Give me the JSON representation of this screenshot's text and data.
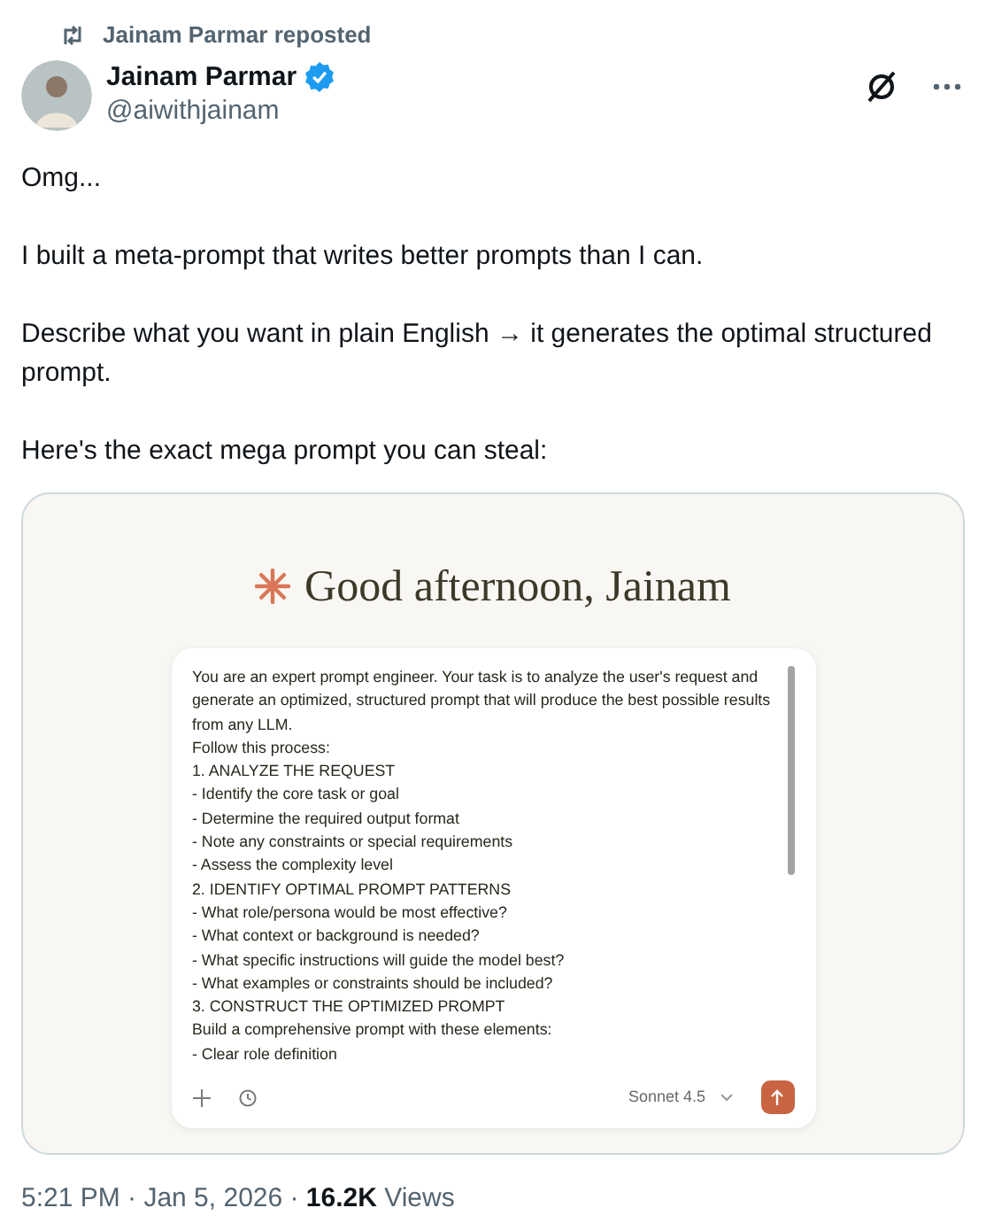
{
  "repost": {
    "text": "Jainam Parmar reposted"
  },
  "author": {
    "name": "Jainam Parmar",
    "verified": true,
    "handle": "@aiwithjainam"
  },
  "body": [
    "Omg...",
    "I built a meta-prompt that writes better prompts than I can.",
    "Describe what you want in plain English → it generates the optimal structured prompt.",
    "Here's the exact mega prompt you can steal:"
  ],
  "media": {
    "greeting": "Good afternoon, Jainam",
    "prompt_lines": [
      "You are an expert prompt engineer. Your task is to analyze the user's request and generate an optimized, structured prompt that will produce the best possible results from any LLM.",
      "Follow this process:",
      "1. ANALYZE THE REQUEST",
      "- Identify the core task or goal",
      "- Determine the required output format",
      "- Note any constraints or special requirements",
      "- Assess the complexity level",
      "2. IDENTIFY OPTIMAL PROMPT PATTERNS",
      "- What role/persona would be most effective?",
      "- What context or background is needed?",
      "- What specific instructions will guide the model best?",
      "- What examples or constraints should be included?",
      "3. CONSTRUCT THE OPTIMIZED PROMPT",
      "Build a comprehensive prompt with these elements:",
      "- Clear role definition"
    ],
    "model": "Sonnet 4.5"
  },
  "footer": {
    "time": "5:21 PM · Jan 5, 2026 · ",
    "views_count": "16.2K",
    "views_label": " Views"
  }
}
